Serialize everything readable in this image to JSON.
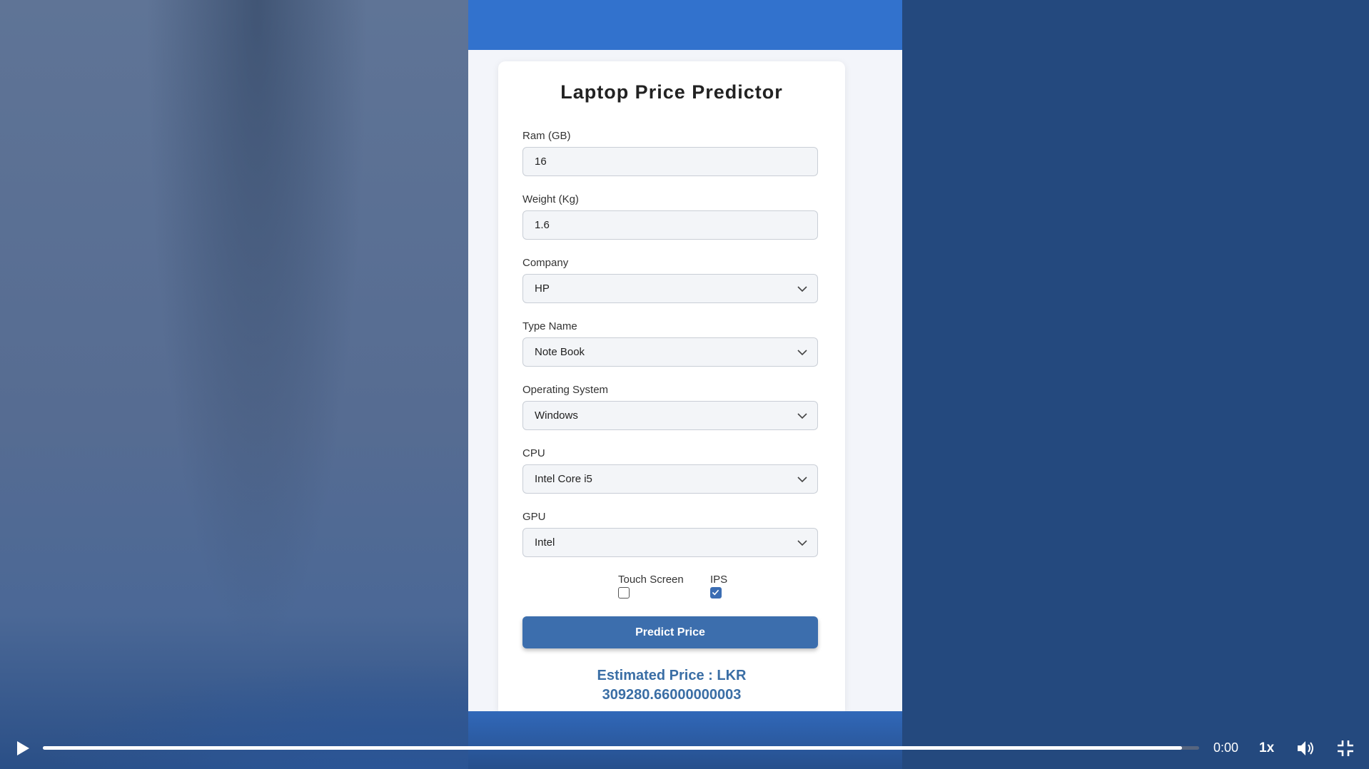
{
  "form": {
    "title": "Laptop Price Predictor",
    "ram": {
      "label": "Ram (GB)",
      "value": "16"
    },
    "weight": {
      "label": "Weight (Kg)",
      "value": "1.6"
    },
    "company": {
      "label": "Company",
      "selected": "HP"
    },
    "type_name": {
      "label": "Type Name",
      "selected": "Note Book"
    },
    "os": {
      "label": "Operating System",
      "selected": "Windows"
    },
    "cpu": {
      "label": "CPU",
      "selected": "Intel Core i5"
    },
    "gpu": {
      "label": "GPU",
      "selected": "Intel"
    },
    "touch_screen": {
      "label": "Touch Screen",
      "checked": false
    },
    "ips": {
      "label": "IPS",
      "checked": true
    },
    "predict_label": "Predict Price",
    "result_line1": "Estimated Price : LKR",
    "result_line2": "309280.66000000003"
  },
  "player": {
    "time": "0:00",
    "speed": "1x",
    "progress": 0.985,
    "icons": [
      "play-icon",
      "volume-icon",
      "exit-fullscreen-icon",
      "chevron-down-icon",
      "checkmark-icon"
    ]
  },
  "colors": {
    "accent": "#3c6ead",
    "header": "#3272cd",
    "result": "#3a6ea5"
  }
}
